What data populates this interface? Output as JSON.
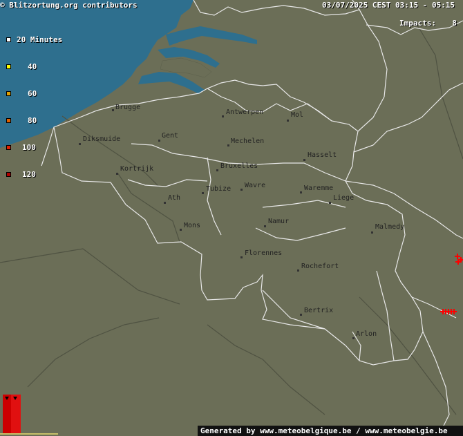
{
  "header": {
    "copyright": "© Blitzortung.org contributors",
    "datetime": "03/07/2025 CEST 03:15 - 05:15"
  },
  "impacts": {
    "label": "Impacts:",
    "value": "8"
  },
  "legend": [
    {
      "label": "20 Minutes",
      "color": "#ffffff"
    },
    {
      "label": "40",
      "color": "#ffff00"
    },
    {
      "label": "60",
      "color": "#e0a000"
    },
    {
      "label": "80",
      "color": "#e06000"
    },
    {
      "label": "100",
      "color": "#e02000"
    },
    {
      "label": "120",
      "color": "#b00000"
    }
  ],
  "cities": [
    "Brugge",
    "Antwerpen",
    "Gent",
    "Diksmuide",
    "Mechelen",
    "Mol",
    "Hasselt",
    "Kortrijk",
    "Bruxelles",
    "Tubize",
    "Wavre",
    "Waremme",
    "Liege",
    "Ath",
    "Mons",
    "Namur",
    "Malmedy",
    "Florennes",
    "Rochefort",
    "Bertrix",
    "Arlon"
  ],
  "colors": {
    "land": "#6b6e57",
    "sea": "#2e6f8e",
    "border": "#e8e8e8",
    "strike": "#ff0000"
  },
  "footer": {
    "text": "Generated by www.meteobelgique.be / www.meteobelgie.be"
  }
}
